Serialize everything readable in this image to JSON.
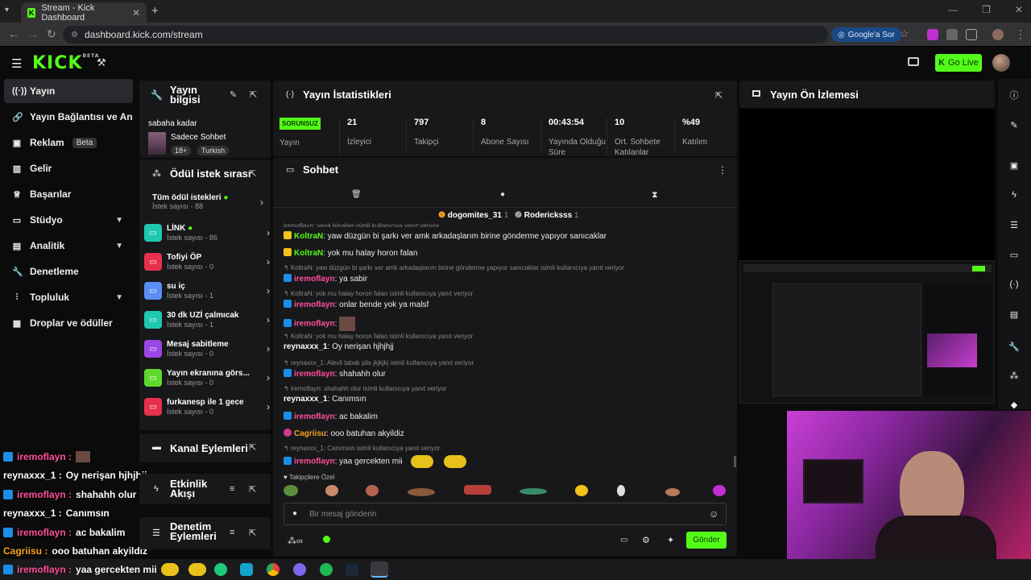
{
  "browser": {
    "tab_title": "Stream - Kick Dashboard",
    "url": "dashboard.kick.com/stream",
    "google_ask": "Google'a Sor"
  },
  "header": {
    "logo": "KICK",
    "logo_sup": "BETA",
    "go_live": "Go Live"
  },
  "sidebar": {
    "items": [
      {
        "label": "Yayın",
        "icon": "broadcast-icon"
      },
      {
        "label": "Yayın Bağlantısı ve Anahtar",
        "icon": "link-icon"
      },
      {
        "label": "Reklam",
        "icon": "ad-icon",
        "badge": "Beta"
      },
      {
        "label": "Gelir",
        "icon": "bars-icon"
      },
      {
        "label": "Başarılar",
        "icon": "trophy-icon"
      },
      {
        "label": "Stüdyo",
        "icon": "studio-icon"
      },
      {
        "label": "Analitik",
        "icon": "chart-icon"
      },
      {
        "label": "Denetleme",
        "icon": "wrench-icon"
      },
      {
        "label": "Topluluk",
        "icon": "community-icon"
      },
      {
        "label": "Droplar ve ödüller",
        "icon": "gift-icon"
      }
    ]
  },
  "overlay_chat": [
    {
      "user": "iremoflayn :",
      "text": "",
      "color": "#ff4f9a"
    },
    {
      "user": "reynaxxx_1 :",
      "text": "Oy nerişan hjhjhjj",
      "color": "#ffffff"
    },
    {
      "user": "iremoflayn :",
      "text": "shahahh olur",
      "color": "#ff4f9a"
    },
    {
      "user": "reynaxxx_1 :",
      "text": "Canımsın",
      "color": "#ffffff"
    },
    {
      "user": "iremoflayn :",
      "text": "ac bakalim",
      "color": "#ff4f9a"
    },
    {
      "user": "Cagriisu :",
      "text": "ooo batuhan akyildiz",
      "color": "#f7a21b"
    },
    {
      "user": "iremoflayn :",
      "text": "yaa gercekten mii",
      "color": "#ff4f9a"
    }
  ],
  "stream_info": {
    "title_line1": "Yayın",
    "title_line2": "bilgisi",
    "stream_title": "sabaha kadar",
    "category": "Sadece Sohbet",
    "tag_age": "18+",
    "tag_lang": "Turkish"
  },
  "rewards": {
    "title": "Ödül istek sırası",
    "all_label": "Tüm ödül istekleri",
    "all_count": "İstek sayısı - 88",
    "items": [
      {
        "name": "LİNK",
        "count": "İstek sayısı - 86",
        "color": "#1fc8b0",
        "online": true
      },
      {
        "name": "Tofiyi ÖP",
        "count": "İstek sayısı - 0",
        "color": "#e8304e"
      },
      {
        "name": "su iç",
        "count": "İstek sayısı - 1",
        "color": "#5b8ff5"
      },
      {
        "name": "30 dk UZİ çalmıcak",
        "count": "İstek sayısı - 1",
        "color": "#1fc8b0"
      },
      {
        "name": "Mesaj sabitleme",
        "count": "İstek sayısı - 0",
        "color": "#9b46e6"
      },
      {
        "name": "Yayın ekranına görs...",
        "count": "İstek sayısı - 0",
        "color": "#5fd82e"
      },
      {
        "name": "furkanesp ile 1 gece",
        "count": "İstek sayısı - 0",
        "color": "#e8304e"
      }
    ]
  },
  "channel_actions": {
    "title": "Kanal Eylemleri"
  },
  "activity_feed": {
    "title_line1": "Etkinlik",
    "title_line2": "Akışı"
  },
  "moderation_actions": {
    "title_line1": "Denetim",
    "title_line2": "Eylemleri"
  },
  "stats": {
    "title": "Yayın İstatistikleri",
    "status": "SORUNSUZ",
    "status_label": "Yayın",
    "items": [
      {
        "value": "21",
        "label": "İzleyici"
      },
      {
        "value": "797",
        "label": "Takipçi"
      },
      {
        "value": "8",
        "label": "Abone Sayısı"
      },
      {
        "value": "00:43:54",
        "label": "Yayında Olduğu Süre"
      },
      {
        "value": "10",
        "label": "Ort. Sohbete Katılanlar"
      },
      {
        "value": "%49",
        "label": "Katılım"
      }
    ]
  },
  "preview": {
    "title": "Yayın Ön İzlemesi"
  },
  "chat": {
    "title": "Sohbet",
    "top_gifters": [
      {
        "name": "dogomites_31",
        "count": "1"
      },
      {
        "name": "Rodericksss",
        "count": "1"
      }
    ],
    "messages": [
      {
        "type": "reply",
        "text": "iremoflayn: vega binaber isimli kullanıcıya yanıt veriyor"
      },
      {
        "type": "msg",
        "user": "KoltraN",
        "color": "green",
        "text": "yaw düzgün bi şarkı ver amk arkadaşlarım birine gönderme yapıyor sanıcaklar"
      },
      {
        "type": "msg",
        "user": "KoltraN",
        "color": "green",
        "text": "yok mu halay horon falan"
      },
      {
        "type": "reply",
        "text": "KoltraN: yaw düzgün bi şarkı ver amk arkadaşlarım birine gönderme yapıyor sanıcaklar isimli kullanıcıya yanıt veriyor"
      },
      {
        "type": "msg",
        "user": "iremoflayn",
        "color": "pink",
        "text": "ya sabir"
      },
      {
        "type": "reply",
        "text": "KoltraN: yok mu halay horon falan isimli kullanıcıya yanıt veriyor"
      },
      {
        "type": "msg",
        "user": "iremoflayn",
        "color": "pink",
        "text": "onlar bende yok ya malsf"
      },
      {
        "type": "msg",
        "user": "iremoflayn",
        "color": "pink",
        "text": ""
      },
      {
        "type": "reply",
        "text": "KoltraN: yok mu halay horon falan isimli kullanıcıya yanıt veriyor"
      },
      {
        "type": "msg",
        "user": "reynaxxx_1",
        "color": "white",
        "text": "Oy nerişan hjhjhjj"
      },
      {
        "type": "reply",
        "text": "reynaxxx_1: Alevli tabak plis jkjkjkj isimli kullanıcıya yanıt veriyor"
      },
      {
        "type": "msg",
        "user": "iremoflayn",
        "color": "pink",
        "text": "shahahh olur"
      },
      {
        "type": "reply",
        "text": "iremoflayn: shahahh olur isimli kullanıcıya yanıt veriyor"
      },
      {
        "type": "msg",
        "user": "reynaxxx_1",
        "color": "white",
        "text": "Canımsın"
      },
      {
        "type": "msg",
        "user": "iremoflayn",
        "color": "pink",
        "text": "ac bakalim"
      },
      {
        "type": "msg",
        "user": "Cagriisu",
        "color": "orange",
        "text": "ooo batuhan akyildiz"
      },
      {
        "type": "reply",
        "text": "reynaxxx_1: Canımsın isimli kullanıcıya yanıt veriyor"
      },
      {
        "type": "msg",
        "user": "iremoflayn",
        "color": "pink",
        "text": "yaa gercekten mii"
      }
    ],
    "emote_section": "Takipçilere Özel",
    "input_placeholder": "Bir mesaj gönderin",
    "send": "Gönder"
  }
}
